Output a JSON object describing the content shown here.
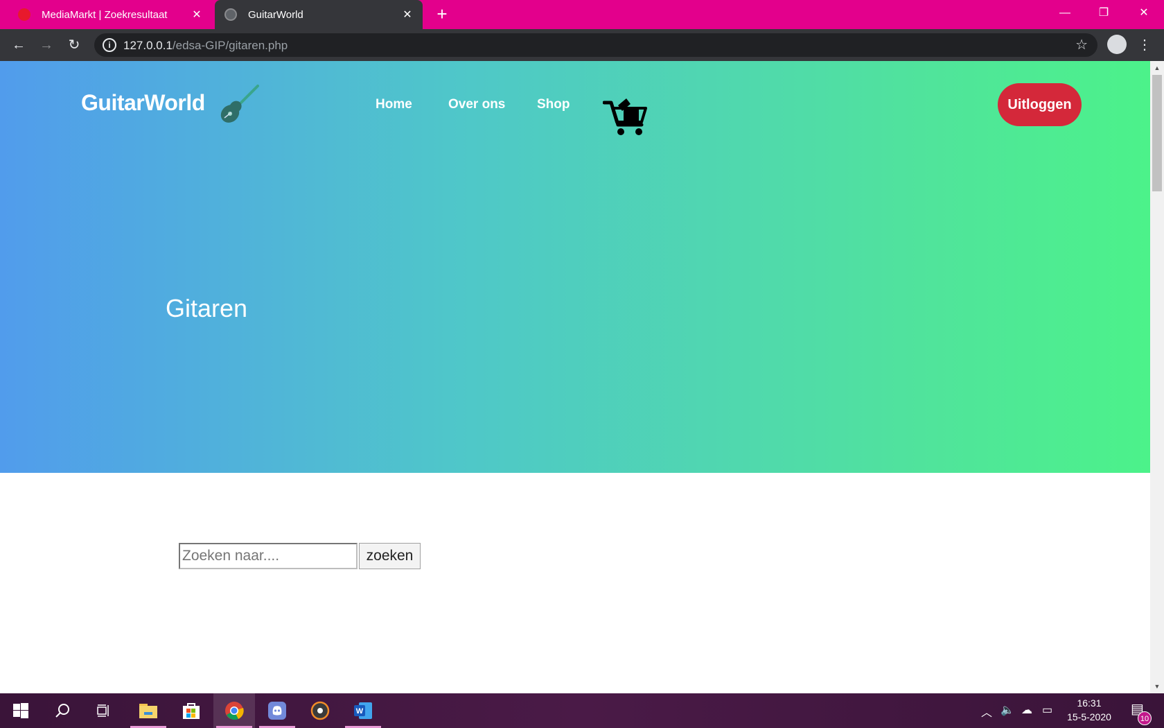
{
  "browser": {
    "tabs": [
      {
        "title": "MediaMarkt | Zoekresultaat",
        "close": "✕"
      },
      {
        "title": "GuitarWorld",
        "close": "✕"
      }
    ],
    "new_tab": "+",
    "window_controls": {
      "minimize": "—",
      "restore": "❐",
      "close": "✕"
    },
    "nav": {
      "back": "←",
      "forward": "→",
      "reload": "↻"
    },
    "url_host": "127.0.0.1",
    "url_path": "/edsa-GIP/gitaren.php",
    "bookmark": "☆",
    "menu": "⋮",
    "accent": "#e3008c"
  },
  "site": {
    "logo": "GuitarWorld",
    "nav": [
      {
        "label": "Home"
      },
      {
        "label": "Over ons"
      },
      {
        "label": "Shop"
      }
    ],
    "logout_label": "Uitloggen",
    "hero_title": "Gitaren",
    "search_placeholder": "Zoeken naar....",
    "search_button": "zoeken",
    "colors": {
      "gradient_start": "#519cec",
      "gradient_end": "#4cf28a",
      "logout": "#d4283a"
    }
  },
  "taskbar": {
    "time": "16:31",
    "date": "15-5-2020",
    "notification_count": "10",
    "icons": [
      "windows-start-icon",
      "search-icon",
      "task-view-icon",
      "file-explorer-icon",
      "microsoft-store-icon",
      "chrome-icon",
      "discord-icon",
      "media-player-icon",
      "word-icon"
    ]
  }
}
